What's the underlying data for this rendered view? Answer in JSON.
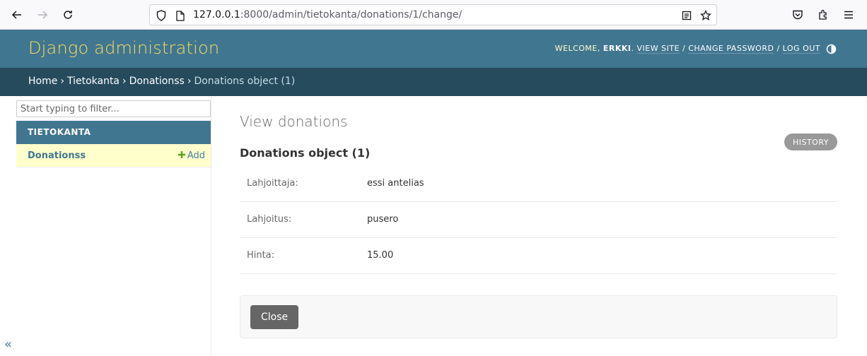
{
  "browser": {
    "url_host": "127.0.0.1",
    "url_rest": ":8000/admin/tietokanta/donations/1/change/"
  },
  "header": {
    "branding": "Django administration",
    "welcome": "WELCOME,",
    "username": "ERKKI",
    "view_site": "VIEW SITE",
    "change_password": "CHANGE PASSWORD",
    "log_out": "LOG OUT"
  },
  "breadcrumbs": {
    "home": "Home",
    "app": "Tietokanta",
    "model": "Donationss",
    "current": "Donations object (1)"
  },
  "sidebar": {
    "filter_placeholder": "Start typing to filter...",
    "app_caption": "TIETOKANTA",
    "model_name": "Donationss",
    "add_label": "Add",
    "collapse_glyph": "«"
  },
  "main": {
    "page_title": "View donations",
    "history_label": "HISTORY",
    "object_title": "Donations object (1)",
    "fields": [
      {
        "label": "Lahjoittaja:",
        "value": "essi antelias"
      },
      {
        "label": "Lahjoitus:",
        "value": "pusero"
      },
      {
        "label": "Hinta:",
        "value": "15.00"
      }
    ],
    "close_label": "Close"
  },
  "colors": {
    "header_bg": "#417690",
    "branding": "#f5dd5d",
    "breadcrumbs_bg": "#264b5d",
    "selected_row": "#ffffcc"
  }
}
